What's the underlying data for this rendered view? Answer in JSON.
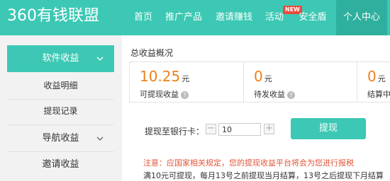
{
  "header": {
    "logo": "360有钱联盟",
    "nav": [
      {
        "label": "首页"
      },
      {
        "label": "推广产品"
      },
      {
        "label": "邀请赚钱"
      },
      {
        "label": "活动",
        "badge": "NEW"
      },
      {
        "label": "安全盾"
      },
      {
        "label": "个人中心",
        "active": true
      }
    ]
  },
  "sidebar": {
    "items": [
      {
        "label": "软件收益",
        "active": true,
        "group": true
      },
      {
        "label": "收益明细"
      },
      {
        "label": "提现记录"
      },
      {
        "label": "导航收益",
        "group": true
      },
      {
        "label": "邀请收益",
        "group": true
      }
    ]
  },
  "main": {
    "section_title": "总收益概况",
    "summary": [
      {
        "value": "10.25",
        "unit": "元",
        "label": "可提现收益",
        "help": "?"
      },
      {
        "value": "0",
        "unit": "元",
        "label": "待发收益",
        "help": "?"
      },
      {
        "value": "0",
        "unit": "元",
        "label": "结算中收益"
      }
    ],
    "withdraw": {
      "label": "提现至银行卡：",
      "minus": "−",
      "plus": "+",
      "amount": "10",
      "button": "提现"
    },
    "notice": "注意：应国家相关规定，您的提现收益平台将会为您进行报税",
    "rule": "满10元可提现，每月13号之前提现当月结算，13号之后提现下月结算"
  },
  "colors": {
    "accent": "#3cc8b4",
    "amount": "#f08019",
    "notice": "#e05537"
  }
}
